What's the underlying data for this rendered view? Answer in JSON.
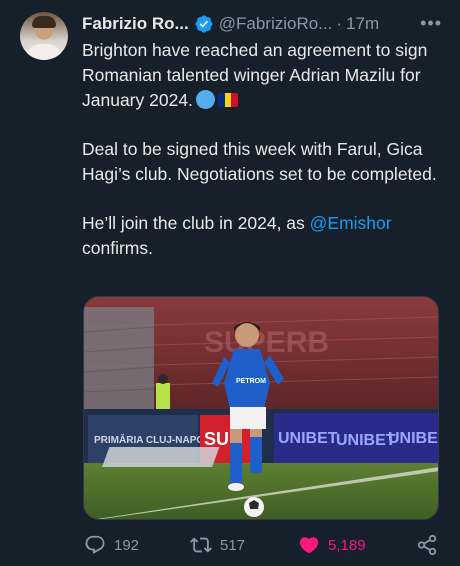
{
  "author": {
    "name": "Fabrizio Ro...",
    "handle": "@FabrizioRo...",
    "separator": "·",
    "time": "17m"
  },
  "tweet": {
    "para1": "Brighton have reached an agreement to sign Romanian talented winger Adrian Mazilu for January 2024.",
    "para2": "Deal to be signed this week with Farul, Gica Hagi’s club. Negotiations set to be completed.",
    "para3_before": "He’ll join the club in 2024, as ",
    "mention": "@Emishor",
    "para3_after": " confirms."
  },
  "emoji": [
    "blue-circle",
    "romania-flag"
  ],
  "media": {
    "description_icon": "football-player-photo",
    "boards": [
      "PRIMĂRIA CLUJ-NAPOCA",
      "UNIBET",
      "UNIBET",
      "UNIBET",
      "SU"
    ],
    "shirt_sponsor": "PETROM"
  },
  "actions": {
    "replies": "192",
    "reposts": "517",
    "likes": "5,189"
  },
  "colors": {
    "background": "#15202b",
    "text": "#e7e9ea",
    "muted": "#8b98a5",
    "link": "#1d9bf0",
    "like": "#f91880"
  }
}
